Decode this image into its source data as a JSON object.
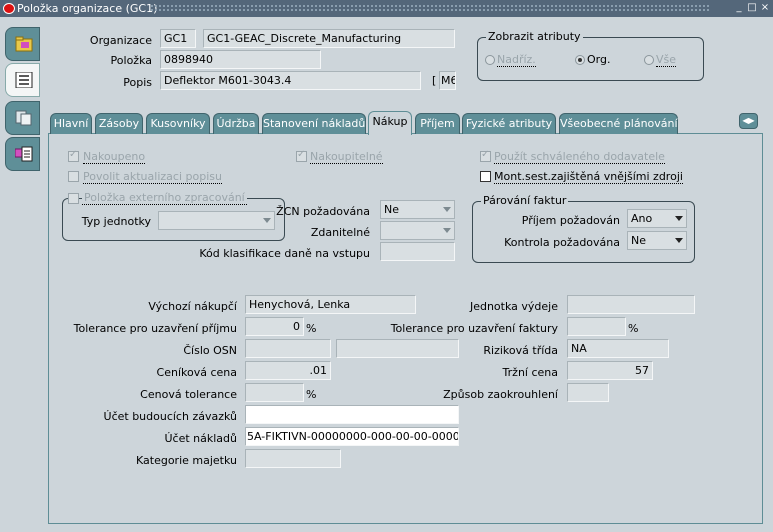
{
  "window": {
    "title": "Položka organizace (GC1)",
    "controls": [
      "_",
      "□",
      "×"
    ]
  },
  "sidebar": [
    {
      "name": "folder-icon",
      "active": false
    },
    {
      "name": "list-icon",
      "active": true
    },
    {
      "name": "attachments-icon",
      "active": false
    },
    {
      "name": "categories-icon",
      "active": false
    }
  ],
  "header": {
    "organizace_label": "Organizace",
    "organizace_code": "GC1",
    "organizace_name": "GC1-GEAC_Discrete_Manufacturing",
    "polozka_label": "Položka",
    "polozka_value": "0898940",
    "popis_label": "Popis",
    "popis_value": "Deflektor M601-3043.4",
    "descflex_bracket": "[",
    "descflex_value": "M6",
    "attr_group_title": "Zobrazit atributy",
    "attr_options": [
      {
        "label": "Nadříz.",
        "selected": false
      },
      {
        "label": "Org.",
        "selected": true
      },
      {
        "label": "Vše",
        "selected": false
      }
    ]
  },
  "tabs": [
    {
      "label": "Hlavní",
      "active": false
    },
    {
      "label": "Zásoby",
      "active": false
    },
    {
      "label": "Kusovníky",
      "active": false
    },
    {
      "label": "Údržba",
      "active": false
    },
    {
      "label": "Stanovení nákladů",
      "active": false
    },
    {
      "label": "Nákup",
      "active": true
    },
    {
      "label": "Příjem",
      "active": false
    },
    {
      "label": "Fyzické atributy",
      "active": false
    },
    {
      "label": "Všeobecné plánování",
      "active": false
    }
  ],
  "nakup": {
    "nakoupeno_label": "Nakoupeno",
    "nakoupitelne_label": "Nakoupitelné",
    "pouzit_schvaleneho_label": "Použít schváleného dodavatele",
    "povolit_aktualizaci_label": "Povolit aktualizaci popisu",
    "mont_sest_label": "Mont.sest.zajištěná vnějšími zdroji",
    "externi_group_title": "Položka externího zpracování",
    "typ_jednotky_label": "Typ jednotky",
    "typ_jednotky_value": "",
    "zcn_label": "ŽCN požadována",
    "zcn_value": "Ne",
    "zdanitelne_label": "Zdanitelné",
    "zdanitelne_value": "",
    "kod_klasifikace_label": "Kód klasifikace daně na vstupu",
    "kod_klasifikace_value": "",
    "parovani_title": "Párování faktur",
    "prijem_pozadovan_label": "Příjem požadován",
    "prijem_pozadovan_value": "Ano",
    "kontrola_pozadovana_label": "Kontrola požadována",
    "kontrola_pozadovana_value": "Ne",
    "vychozi_nakupci_label": "Výchozí nákupčí",
    "vychozi_nakupci_value": "Henychová, Lenka",
    "jednotka_vydeje_label": "Jednotka výdeje",
    "jednotka_vydeje_value": "",
    "tolerance_prijmu_label": "Tolerance pro uzavření příjmu",
    "tolerance_prijmu_value": "0",
    "tolerance_faktury_label": "Tolerance pro uzavření faktury",
    "tolerance_faktury_value": "",
    "percent": "%",
    "cislo_osn_label": "Číslo OSN",
    "cislo_osn_value": "",
    "cislo_osn_desc": "",
    "rizikova_trida_label": "Riziková třída",
    "rizikova_trida_value": "NA",
    "cenikova_cena_label": "Ceníková cena",
    "cenikova_cena_value": ".01",
    "trzni_cena_label": "Tržní cena",
    "trzni_cena_value": "57",
    "cenova_tolerance_label": "Cenová tolerance",
    "cenova_tolerance_value": "",
    "zpusob_zaokrouhleni_label": "Způsob zaokrouhlení",
    "zpusob_zaokrouhleni_value": "",
    "ucet_budoucich_label": "Účet budoucích závazků",
    "ucet_budoucich_value": "",
    "ucet_nakladu_label": "Účet nákladů",
    "ucet_nakladu_value": "5A-FIKTIVN-00000000-000-00-00-000000",
    "kategorie_majetku_label": "Kategorie majetku",
    "kategorie_majetku_value": ""
  }
}
